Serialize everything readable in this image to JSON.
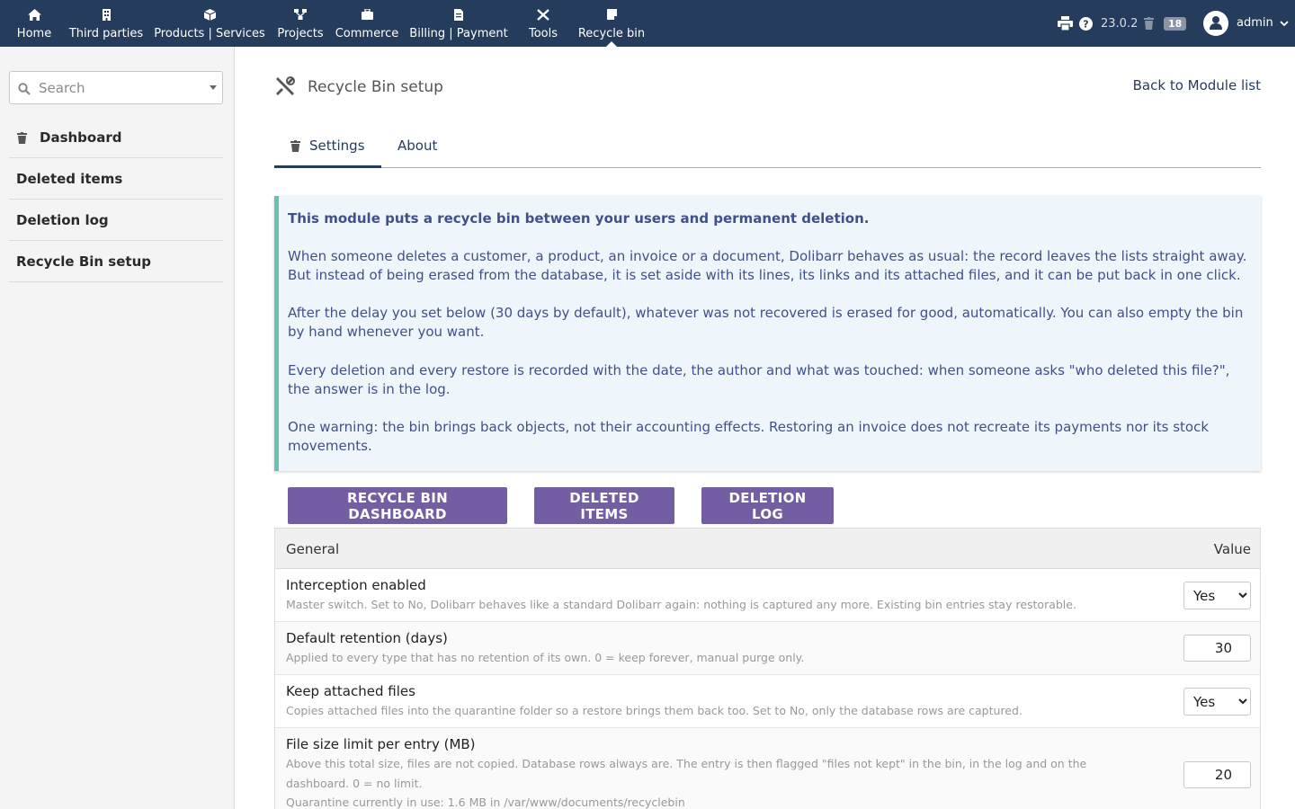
{
  "nav": {
    "items": [
      {
        "label": "Home",
        "icon": "home-icon"
      },
      {
        "label": "Third parties",
        "icon": "building-icon"
      },
      {
        "label": "Products | Services",
        "icon": "cube-icon"
      },
      {
        "label": "Projects",
        "icon": "project-icon"
      },
      {
        "label": "Commerce",
        "icon": "briefcase-icon"
      },
      {
        "label": "Billing | Payment",
        "icon": "invoice-icon"
      },
      {
        "label": "Tools",
        "icon": "tools-icon"
      },
      {
        "label": "Recycle bin",
        "icon": "recycle-bin-icon"
      }
    ],
    "version": "23.0.2",
    "bin_count": "18",
    "user": "admin"
  },
  "sidebar": {
    "search_placeholder": "Search",
    "items": [
      {
        "label": "Dashboard"
      },
      {
        "label": "Deleted items"
      },
      {
        "label": "Deletion log"
      },
      {
        "label": "Recycle Bin setup"
      }
    ]
  },
  "main": {
    "title": "Recycle Bin setup",
    "back_link": "Back to Module list",
    "tabs": [
      {
        "label": "Settings"
      },
      {
        "label": "About"
      }
    ],
    "info": {
      "heading": "This module puts a recycle bin between your users and permanent deletion.",
      "paragraphs": [
        "When someone deletes a customer, a product, an invoice or a document, Dolibarr behaves as usual: the record leaves the lists straight away. But instead of being erased from the database, it is set aside with its lines, its links and its attached files, and it can be put back in one click.",
        "After the delay you set below (30 days by default), whatever was not recovered is erased for good, automatically. You can also empty the bin by hand whenever you want.",
        "Every deletion and every restore is recorded with the date, the author and what was touched: when someone asks \"who deleted this file?\", the answer is in the log.",
        "One warning: the bin brings back objects, not their accounting effects. Restoring an invoice does not recreate its payments nor its stock movements."
      ]
    },
    "buttons": {
      "dashboard": "RECYCLE BIN DASHBOARD",
      "deleted": "DELETED ITEMS",
      "log": "DELETION LOG"
    },
    "table": {
      "col_general": "General",
      "col_value": "Value",
      "rows": [
        {
          "label": "Interception enabled",
          "desc": "Master switch. Set to No, Dolibarr behaves like a standard Dolibarr again: nothing is captured any more. Existing bin entries stay restorable.",
          "value": "Yes"
        },
        {
          "label": "Default retention (days)",
          "desc": "Applied to every type that has no retention of its own. 0 = keep forever, manual purge only.",
          "value": "30"
        },
        {
          "label": "Keep attached files",
          "desc": "Copies attached files into the quarantine folder so a restore brings them back too. Set to No, only the database rows are captured.",
          "value": "Yes"
        },
        {
          "label": "File size limit per entry (MB)",
          "desc": "Above this total size, files are not copied. Database rows always are. The entry is then flagged \"files not kept\" in the bin, in the log and on the dashboard. 0 = no limit.",
          "desc2": "Quarantine currently in use: 1.6 MB in /var/www/documents/recyclebin",
          "value": "20"
        }
      ]
    }
  }
}
